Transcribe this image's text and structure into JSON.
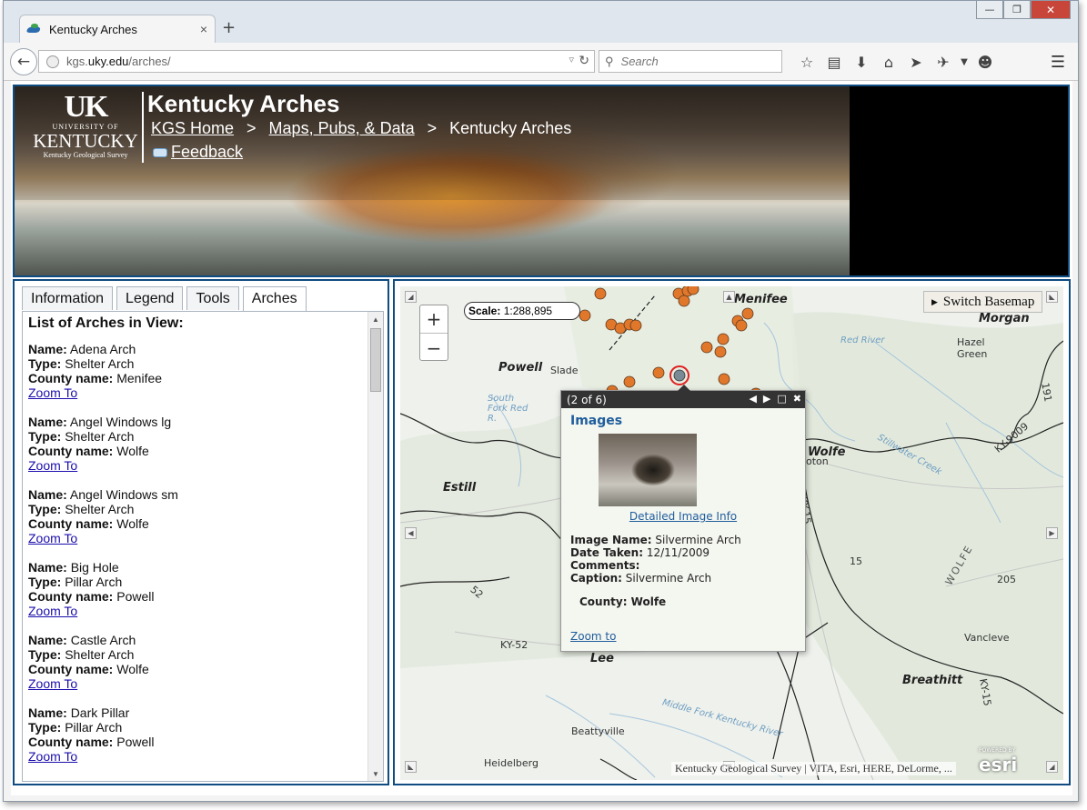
{
  "browser": {
    "tab_title": "Kentucky Arches",
    "tab_close": "×",
    "new_tab": "+",
    "url_prefix": "kgs.",
    "url_host": "uky.edu",
    "url_path": "/arches/",
    "search_placeholder": "Search",
    "win_min": "—",
    "win_max": "❐",
    "win_close": "✕"
  },
  "banner": {
    "logo_uk": "UK",
    "logo_university": "UNIVERSITY OF",
    "logo_kentucky": "KENTUCKY",
    "logo_kgs": "Kentucky Geological Survey",
    "title": "Kentucky Arches",
    "breadcrumb": {
      "home": "KGS Home",
      "sep1": ">",
      "maps": "Maps, Pubs, & Data",
      "sep2": ">",
      "current": "Kentucky Arches"
    },
    "feedback": "Feedback"
  },
  "panel": {
    "tabs": [
      "Information",
      "Legend",
      "Tools",
      "Arches"
    ],
    "active_tab": "Arches",
    "heading": "List of Arches in View:",
    "labels": {
      "name": "Name:",
      "type": "Type:",
      "county": "County name:",
      "zoom": "Zoom To"
    },
    "arches": [
      {
        "name": "Adena Arch",
        "type": "Shelter Arch",
        "county": "Menifee"
      },
      {
        "name": "Angel Windows lg",
        "type": "Shelter Arch",
        "county": "Wolfe"
      },
      {
        "name": "Angel Windows sm",
        "type": "Shelter Arch",
        "county": "Wolfe"
      },
      {
        "name": "Big Hole",
        "type": "Pillar Arch",
        "county": "Powell"
      },
      {
        "name": "Castle Arch",
        "type": "Shelter Arch",
        "county": "Wolfe"
      },
      {
        "name": "Dark Pillar",
        "type": "Pillar Arch",
        "county": "Powell"
      }
    ]
  },
  "map": {
    "scale_label": "Scale:",
    "scale_value": "1:288,895",
    "zoom_in": "+",
    "zoom_out": "−",
    "basemap_button": "Switch Basemap",
    "labels": {
      "menifee": "Menifee",
      "morgan": "Morgan",
      "hazel_green": "Hazel Green",
      "powell": "Powell",
      "slade": "Slade",
      "wolfe": "Wolfe",
      "estill": "Estill",
      "lee": "Lee",
      "breathitt": "Breathitt",
      "vancleve": "Vancleve",
      "beattyville": "Beattyville",
      "heidelberg": "Heidelberg",
      "red_river": "Red River",
      "stillwater": "Stillwater Creek",
      "middle_fork": "Middle Fork Kentucky River",
      "south_fork": "South Fork Red R.",
      "ky9009": "KY-9009",
      "ky52": "KY-52",
      "r52": "52",
      "r15": "15",
      "r205": "205",
      "r191": "191",
      "ky15": "KY-15",
      "wolfe_big": "WOLFE",
      "oton": "oton"
    },
    "attribution": "Kentucky Geological Survey | VITA, Esri, HERE, DeLorme, ...",
    "esri_powered": "POWERED BY",
    "esri": "esri",
    "popup": {
      "counter": "(2 of 6)",
      "section_title": "Images",
      "detail_link": "Detailed Image Info",
      "fields": [
        {
          "label": "Image Name:",
          "value": "Silvermine Arch"
        },
        {
          "label": "Date Taken:",
          "value": "12/11/2009"
        },
        {
          "label": "Comments:",
          "value": ""
        },
        {
          "label": "Caption:",
          "value": "Silvermine Arch"
        }
      ],
      "county": "County: Wolfe",
      "zoom_to": "Zoom to"
    }
  },
  "colors": {
    "frame_blue": "#0f4c81",
    "link_blue": "#1a0dab",
    "marker_orange": "#e0772a",
    "marker_selected": "#e02020"
  }
}
